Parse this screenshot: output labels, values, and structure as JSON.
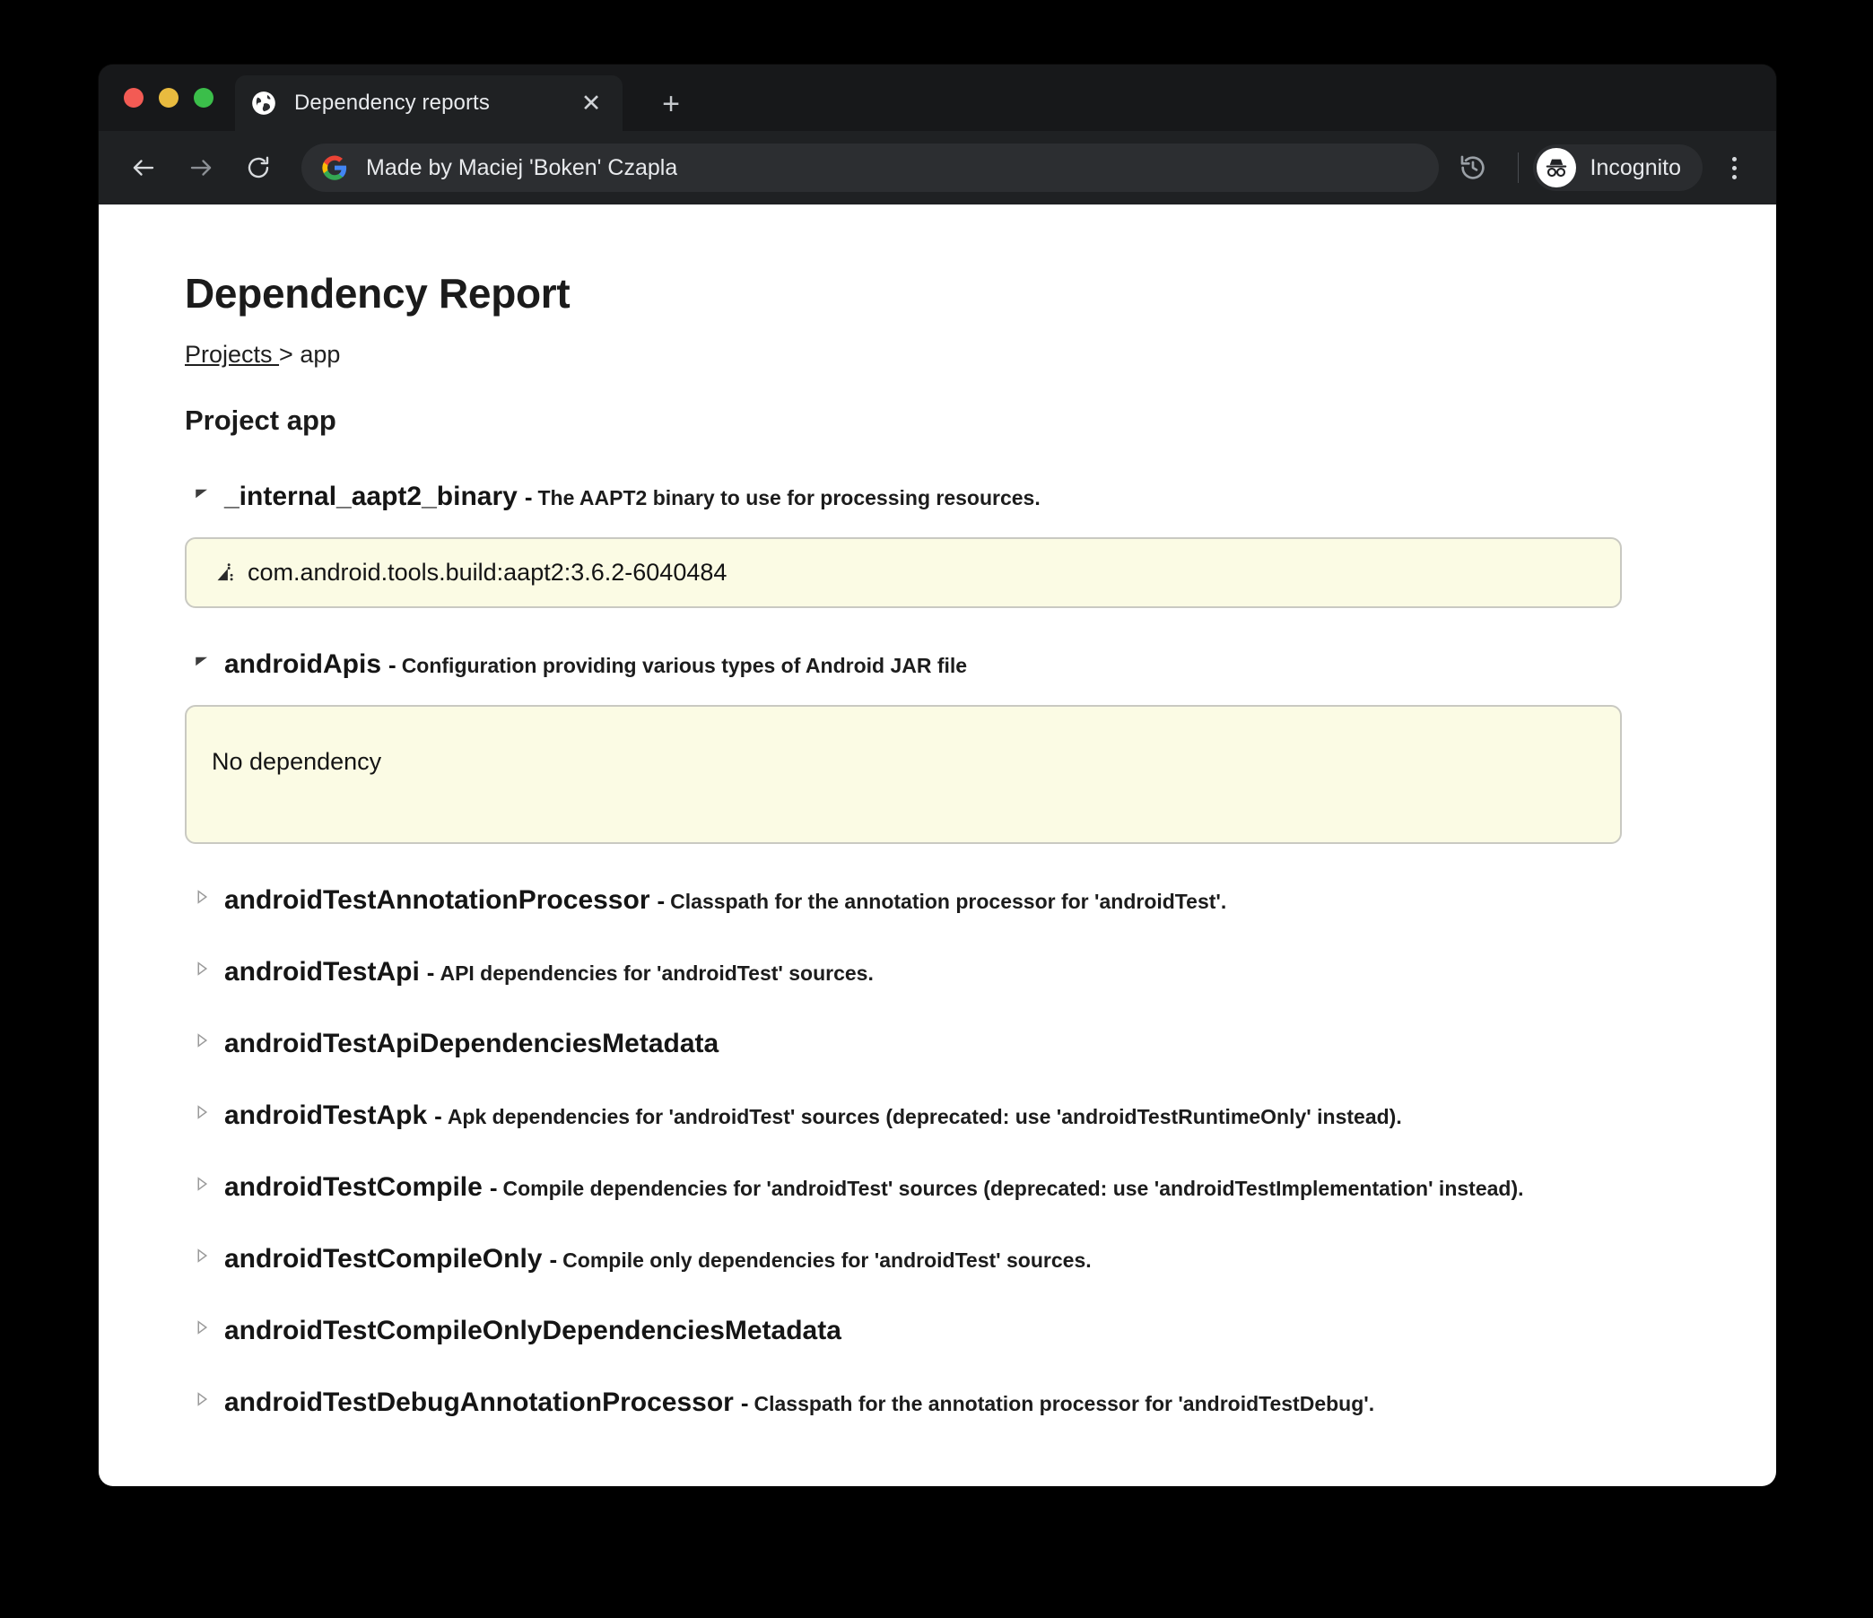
{
  "browser": {
    "tab": {
      "title": "Dependency reports",
      "favicon": "globe-icon",
      "close": "✕"
    },
    "new_tab": "+",
    "omnibox": {
      "text": "Made by Maciej 'Boken' Czapla",
      "icon": "google-g-icon"
    },
    "profile": {
      "label": "Incognito"
    },
    "traffic_lights": {
      "close_color": "#f35b54",
      "minimize_color": "#e9bb3f",
      "zoom_color": "#3bbe4a"
    }
  },
  "page": {
    "title": "Dependency Report",
    "breadcrumb": {
      "link": "Projects ",
      "separator": "> ",
      "current": "app"
    },
    "project_heading": "Project app",
    "empty_text": "No dependency",
    "configurations": [
      {
        "name": "_internal_aapt2_binary",
        "dash": "-",
        "description": "The AAPT2 binary to use for processing resources.",
        "expanded": true,
        "dependencies": [
          "com.android.tools.build:aapt2:3.6.2-6040484"
        ]
      },
      {
        "name": "androidApis",
        "dash": "-",
        "description": "Configuration providing various types of Android JAR file",
        "expanded": true,
        "dependencies": []
      },
      {
        "name": "androidTestAnnotationProcessor",
        "dash": "-",
        "description": "Classpath for the annotation processor for 'androidTest'.",
        "expanded": false
      },
      {
        "name": "androidTestApi",
        "dash": "-",
        "description": "API dependencies for 'androidTest' sources.",
        "expanded": false
      },
      {
        "name": "androidTestApiDependenciesMetadata",
        "dash": "",
        "description": "",
        "expanded": false
      },
      {
        "name": "androidTestApk",
        "dash": "-",
        "description": "Apk dependencies for 'androidTest' sources (deprecated: use 'androidTestRuntimeOnly' instead).",
        "expanded": false
      },
      {
        "name": "androidTestCompile",
        "dash": "-",
        "description": "Compile dependencies for 'androidTest' sources (deprecated: use 'androidTestImplementation' instead).",
        "expanded": false
      },
      {
        "name": "androidTestCompileOnly",
        "dash": "-",
        "description": "Compile only dependencies for 'androidTest' sources.",
        "expanded": false
      },
      {
        "name": "androidTestCompileOnlyDependenciesMetadata",
        "dash": "",
        "description": "",
        "expanded": false
      },
      {
        "name": "androidTestDebugAnnotationProcessor",
        "dash": "-",
        "description": "Classpath for the annotation processor for 'androidTestDebug'.",
        "expanded": false
      }
    ]
  },
  "colors": {
    "box_bg": "#fbfbe4",
    "box_border": "#c9c9c2",
    "chrome_bg": "#1f2123",
    "tabstrip_bg": "#17181a"
  }
}
